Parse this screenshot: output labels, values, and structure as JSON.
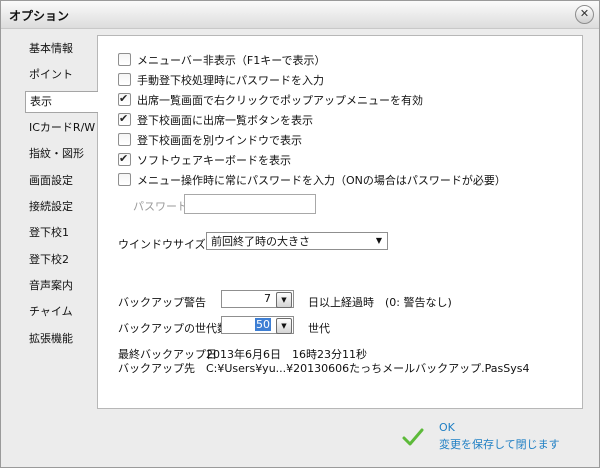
{
  "window": {
    "title": "オプション"
  },
  "sidebar": {
    "items": [
      {
        "label": "基本情報"
      },
      {
        "label": "ポイント"
      },
      {
        "label": "表示",
        "active": true
      },
      {
        "label": "ICカードR/W"
      },
      {
        "label": "指紋・図形"
      },
      {
        "label": "画面設定"
      },
      {
        "label": "接続設定"
      },
      {
        "label": "登下校1"
      },
      {
        "label": "登下校2"
      },
      {
        "label": "音声案内"
      },
      {
        "label": "チャイム"
      },
      {
        "label": "拡張機能"
      }
    ]
  },
  "display": {
    "options": [
      {
        "label": "メニューバー非表示（F1キーで表示）",
        "checked": false
      },
      {
        "label": "手動登下校処理時にパスワードを入力",
        "checked": false
      },
      {
        "label": "出席一覧画面で右クリックでポップアップメニューを有効",
        "checked": true
      },
      {
        "label": "登下校画面に出席一覧ボタンを表示",
        "checked": true
      },
      {
        "label": "登下校画面を別ウインドウで表示",
        "checked": false
      },
      {
        "label": "ソフトウェアキーボードを表示",
        "checked": true
      },
      {
        "label": "メニュー操作時に常にパスワードを入力（ONの場合はパスワードが必要）",
        "checked": false
      }
    ],
    "password_label": "パスワード",
    "password_value": "",
    "window_size_label": "ウインドウサイズ",
    "window_size_value": "前回終了時の大きさ",
    "backup_warning_label": "バックアップ警告",
    "backup_warning_value": "7",
    "backup_warning_suffix": "日以上経過時　(0: 警告なし)",
    "backup_generations_label": "バックアップの世代数",
    "backup_generations_value": "50",
    "backup_generations_suffix": "世代",
    "last_backup_label": "最終バックアップ日",
    "last_backup_value": "2013年6月6日　16時23分11秒",
    "backup_dest_label": "バックアップ先",
    "backup_dest_value": "C:¥Users¥yu...¥20130606たっちメールバックアップ.PasSys4"
  },
  "footer": {
    "ok_label": "OK",
    "ok_sub": "変更を保存して閉じます",
    "ok_color": "#1f7fc4"
  }
}
